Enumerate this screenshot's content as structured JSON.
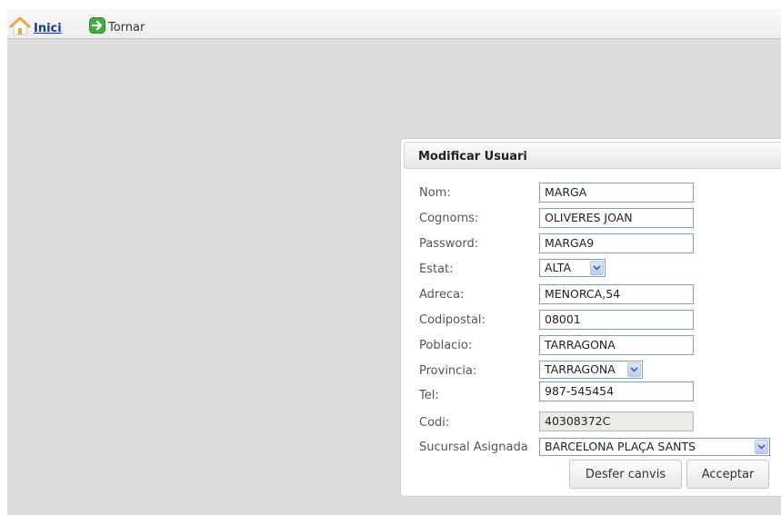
{
  "nav": {
    "home_label": "Inici",
    "back_label": "Tornar"
  },
  "panel": {
    "title": "Modificar Usuari"
  },
  "form": {
    "nom": {
      "label": "Nom:",
      "value": "MARGA"
    },
    "cognoms": {
      "label": "Cognoms:",
      "value": "OLIVERES JOAN"
    },
    "password": {
      "label": "Password:",
      "value": "MARGA9"
    },
    "estat": {
      "label": "Estat:",
      "value": "ALTA"
    },
    "adreca": {
      "label": "Adreca:",
      "value": "MENORCA,54"
    },
    "codipostal": {
      "label": "Codipostal:",
      "value": "08001"
    },
    "poblacio": {
      "label": "Poblacio:",
      "value": "TARRAGONA"
    },
    "provincia": {
      "label": "Provincia:",
      "value": "TARRAGONA"
    },
    "tel": {
      "label": "Tel:",
      "value": "987-545454"
    },
    "codi": {
      "label": "Codi:",
      "value": "40308372C"
    },
    "sucursal": {
      "label": "Sucursal Asignada",
      "value": "BARCELONA PLAÇA SANTS"
    }
  },
  "buttons": {
    "undo": "Desfer canvis",
    "accept": "Acceptar"
  },
  "colors": {
    "background": "#dddddd",
    "link": "#1b3c8c",
    "input_border": "#7f9db9",
    "home_icon": "#f2a43a",
    "back_icon": "#3fae3f"
  }
}
